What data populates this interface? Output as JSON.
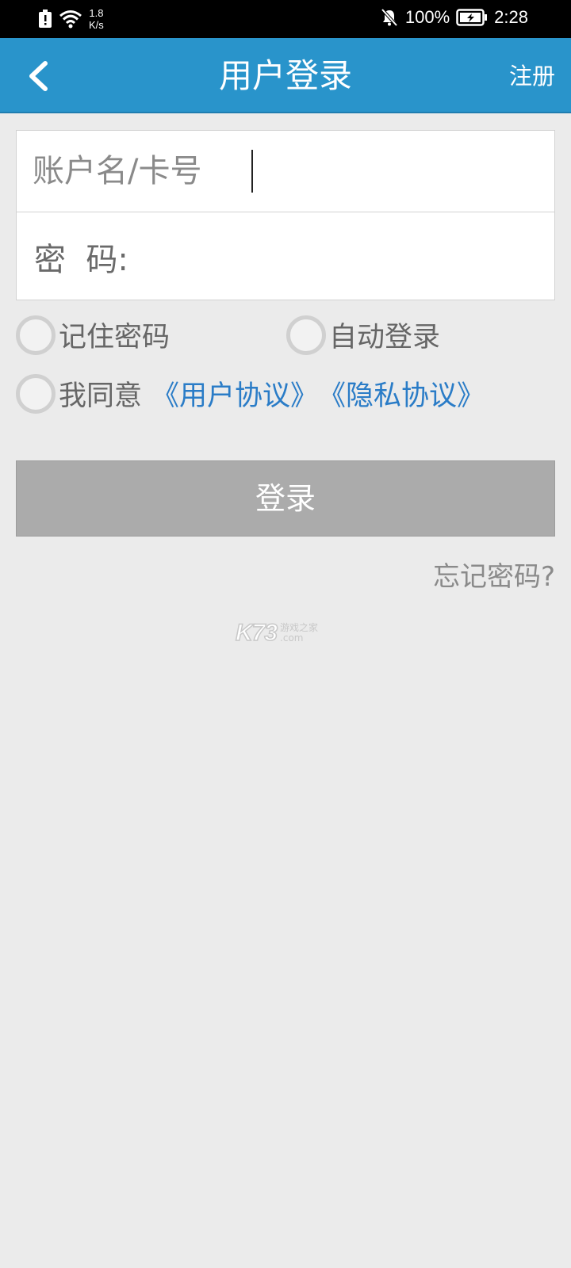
{
  "status_bar": {
    "net_speed_value": "1.8",
    "net_speed_unit": "K/s",
    "battery": "100%",
    "time": "2:28",
    "icons": [
      "battery-saver-icon",
      "wifi-icon",
      "mute-icon",
      "battery-icon"
    ]
  },
  "header": {
    "title": "用户登录",
    "register": "注册",
    "bg_color": "#2994cb"
  },
  "form": {
    "account_placeholder": "账户名/卡号",
    "account_value": "",
    "password_label": "密  码:",
    "password_value": ""
  },
  "options": {
    "remember_password": "记住密码",
    "auto_login": "自动登录",
    "agree": "我同意",
    "user_agreement": "《用户协议》",
    "privacy_agreement": "《隐私协议》"
  },
  "login_button": "登录",
  "forgot_password": "忘记密码?",
  "watermark": {
    "main": "K73",
    "sub_top": "游戏之家",
    "sub_bottom": ".com"
  }
}
